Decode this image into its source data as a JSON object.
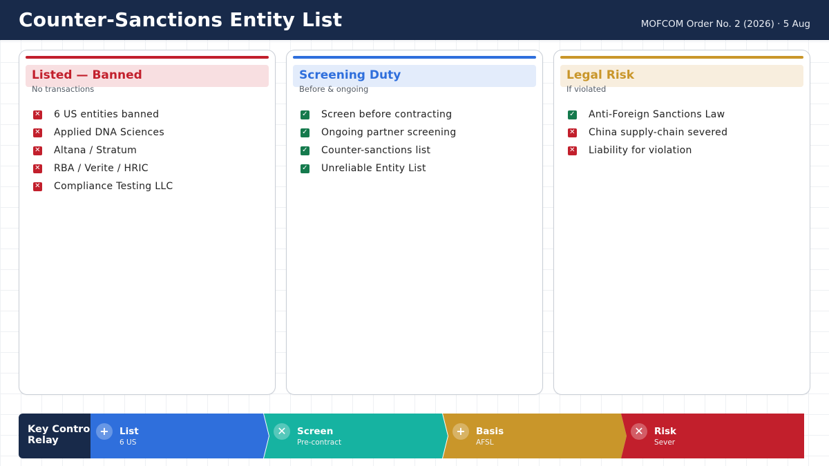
{
  "header": {
    "title": "Counter-Sanctions Entity List",
    "meta": "MOFCOM Order No. 2 (2026) · 5 Aug"
  },
  "cards": [
    {
      "title": "Listed — Banned",
      "subtitle": "No transactions",
      "accent": "#c21f2c",
      "items": [
        {
          "text": "6 US entities banned",
          "icon": "x-icon"
        },
        {
          "text": "Applied DNA Sciences",
          "icon": "x-icon"
        },
        {
          "text": "Altana / Stratum",
          "icon": "x-icon"
        },
        {
          "text": "RBA / Verite / HRIC",
          "icon": "x-icon"
        },
        {
          "text": "Compliance Testing LLC",
          "icon": "x-icon"
        }
      ]
    },
    {
      "title": "Screening Duty",
      "subtitle": "Before & ongoing",
      "accent": "#2f6fdc",
      "items": [
        {
          "text": "Screen before contracting",
          "icon": "check-icon"
        },
        {
          "text": "Ongoing partner screening",
          "icon": "check-icon"
        },
        {
          "text": "Counter-sanctions list",
          "icon": "check-icon"
        },
        {
          "text": "Unreliable Entity List",
          "icon": "check-icon"
        }
      ]
    },
    {
      "title": "Legal Risk",
      "subtitle": "If violated",
      "accent": "#c9962a",
      "items": [
        {
          "text": "Anti-Foreign Sanctions Law",
          "icon": "check-icon"
        },
        {
          "text": "China supply-chain severed",
          "icon": "x-icon"
        },
        {
          "text": "Liability for violation",
          "icon": "x-icon"
        }
      ]
    }
  ],
  "relay": {
    "label": "Key Control Relay",
    "steps": [
      {
        "label": "List",
        "value": "6 US",
        "icon": "plus-icon",
        "color": "#2f6fdc"
      },
      {
        "label": "Screen",
        "value": "Pre-contract",
        "icon": "x-icon",
        "color": "#16b3a1"
      },
      {
        "label": "Basis",
        "value": "AFSL",
        "icon": "plus-icon",
        "color": "#c9962a"
      },
      {
        "label": "Risk",
        "value": "Sever",
        "icon": "x-icon",
        "color": "#c21f2c"
      }
    ]
  }
}
